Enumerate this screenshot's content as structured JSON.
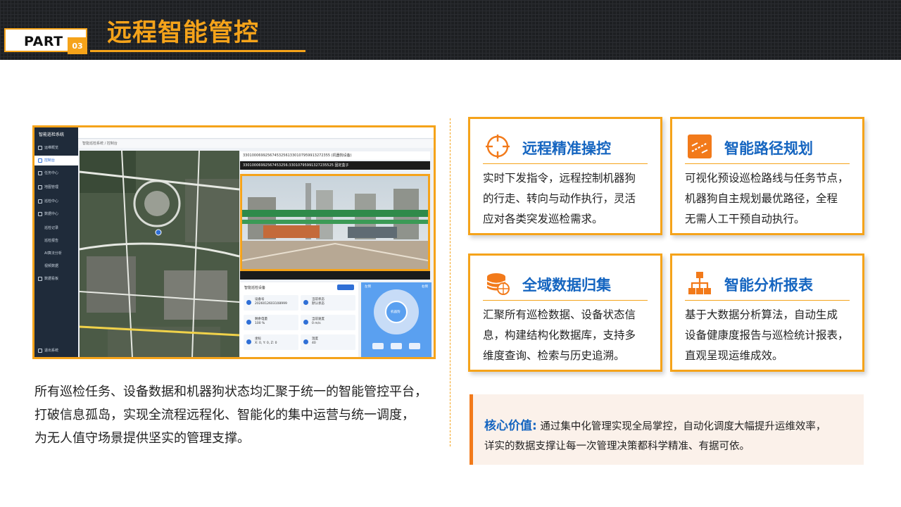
{
  "header": {
    "part_label": "PART",
    "part_number": "03",
    "title": "远程智能管控"
  },
  "screenshot": {
    "app_name": "智能巡检系统",
    "sidebar_items": [
      "运维概览",
      "控制台",
      "任务中心",
      "地图管理",
      "巡检中心",
      "数据中心",
      "巡检记录",
      "巡检报告",
      "AI算法分析",
      "视频数据",
      "数据看板"
    ],
    "sidebar_footer": "退出系统",
    "breadcrumb": "智能巡检系统 / 控制台",
    "camera_header": "330100069925674532561330107959913272355 (机器狗设备)",
    "camera_tab": "33010006992567453256:33010795991327235525  固定盒子",
    "panel_title": "智能巡检设备",
    "cells": [
      {
        "label": "设备号",
        "value": "2026012603108999"
      },
      {
        "label": "当前状态",
        "value": "默认状态"
      },
      {
        "label": "剩余电量",
        "value": "100 %"
      },
      {
        "label": "当前速度",
        "value": "0 m/s"
      },
      {
        "label": "坐标",
        "value": "X: 0, Y: 0, Z: 0"
      },
      {
        "label": "温度",
        "value": "40"
      }
    ],
    "joystick": {
      "left": "左侧",
      "right": "右侧",
      "center": "机器狗"
    }
  },
  "caption": [
    "所有巡检任务、设备数据和机器狗状态均汇聚于统一的智能管控平台，",
    "打破信息孤岛，实现全流程远程化、智能化的集中运营与统一调度，",
    "为无人值守场景提供坚实的管理支撑。"
  ],
  "cards": [
    {
      "icon": "crosshair-icon",
      "title": "远程精准操控",
      "lines": [
        "实时下发指令，远程控制机器狗",
        "的行走、转向与动作执行，灵活",
        "应对各类突发巡检需求。"
      ]
    },
    {
      "icon": "route-icon",
      "title": "智能路径规划",
      "lines": [
        "可视化预设巡检路线与任务节点，",
        "机器狗自主规划最优路径，全程",
        "无需人工干预自动执行。"
      ]
    },
    {
      "icon": "database-icon",
      "title": "全域数据归集",
      "lines": [
        "汇聚所有巡检数据、设备状态信",
        "息，构建结构化数据库，支持多",
        "维度查询、检索与历史追溯。"
      ]
    },
    {
      "icon": "hierarchy-icon",
      "title": "智能分析报表",
      "lines": [
        "基于大数据分析算法，自动生成",
        "设备健康度报告与巡检统计报表，",
        "直观呈现运维成效。"
      ]
    }
  ],
  "core": {
    "label": "核心价值:",
    "line1": "通过集中化管理实现全局掌控，自动化调度大幅提升运维效率，",
    "line2": "详实的数据支撑让每一次管理决策都科学精准、有据可依。"
  },
  "colors": {
    "accent": "#f5a31a",
    "title_blue": "#1565c0",
    "icon_orange": "#f27a1a"
  }
}
